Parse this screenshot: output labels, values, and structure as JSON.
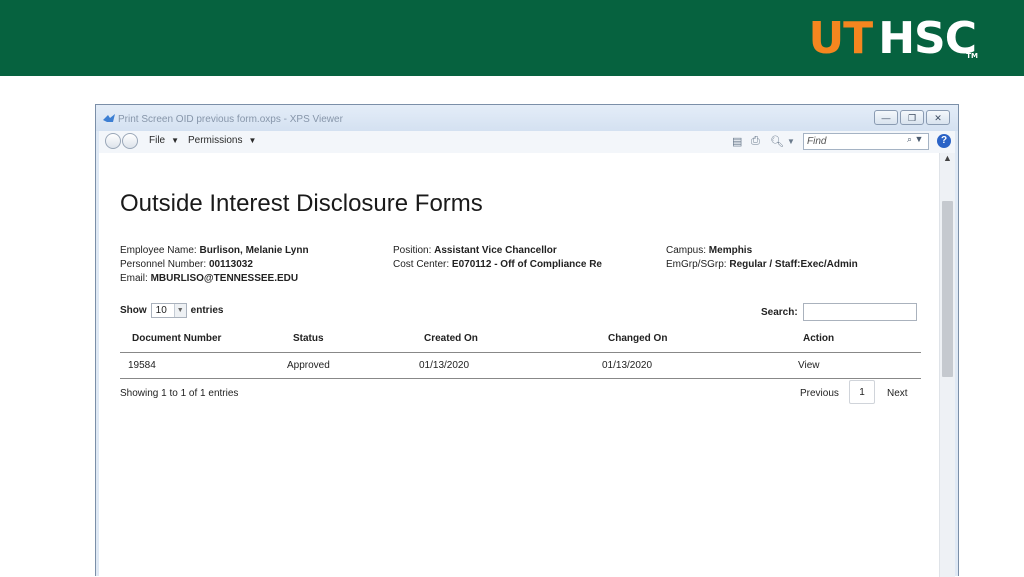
{
  "banner": {
    "logo_ut": "UT",
    "logo_hsc": "HSC",
    "logo_tm": "TM"
  },
  "window": {
    "title": "Print Screen OID previous form.oxps - XPS Viewer",
    "controls": {
      "minimize": "—",
      "restore": "❐",
      "close": "✕"
    }
  },
  "toolbar": {
    "menus": [
      {
        "label": "File"
      },
      {
        "label": "Permissions"
      }
    ],
    "find_placeholder": "Find",
    "help": "?"
  },
  "doc": {
    "page_title": "Outside Interest Disclosure Forms",
    "employee": {
      "name_label": "Employee Name:",
      "name": "Burlison, Melanie Lynn",
      "personnel_label": "Personnel Number:",
      "personnel": "00113032",
      "email_label": "Email:",
      "email": "MBURLISO@TENNESSEE.EDU",
      "position_label": "Position:",
      "position": "Assistant Vice Chancellor",
      "cost_label": "Cost Center:",
      "cost": "E070112 - Off of Compliance Re",
      "campus_label": "Campus:",
      "campus": "Memphis",
      "emgrp_label": "EmGrp/SGrp:",
      "emgrp": "Regular / Staff:Exec/Admin"
    },
    "show_label": "Show",
    "entries_value": "10",
    "entries_label": "entries",
    "search_label": "Search:",
    "table": {
      "headers": [
        "Document Number",
        "Status",
        "Created On",
        "Changed On",
        "Action"
      ],
      "rows": [
        {
          "doc": "19584",
          "status": "Approved",
          "created": "01/13/2020",
          "changed": "01/13/2020",
          "action": "View"
        }
      ]
    },
    "summary": "Showing 1 to 1 of 1 entries",
    "pagination": {
      "previous": "Previous",
      "current": "1",
      "next": "Next"
    }
  }
}
